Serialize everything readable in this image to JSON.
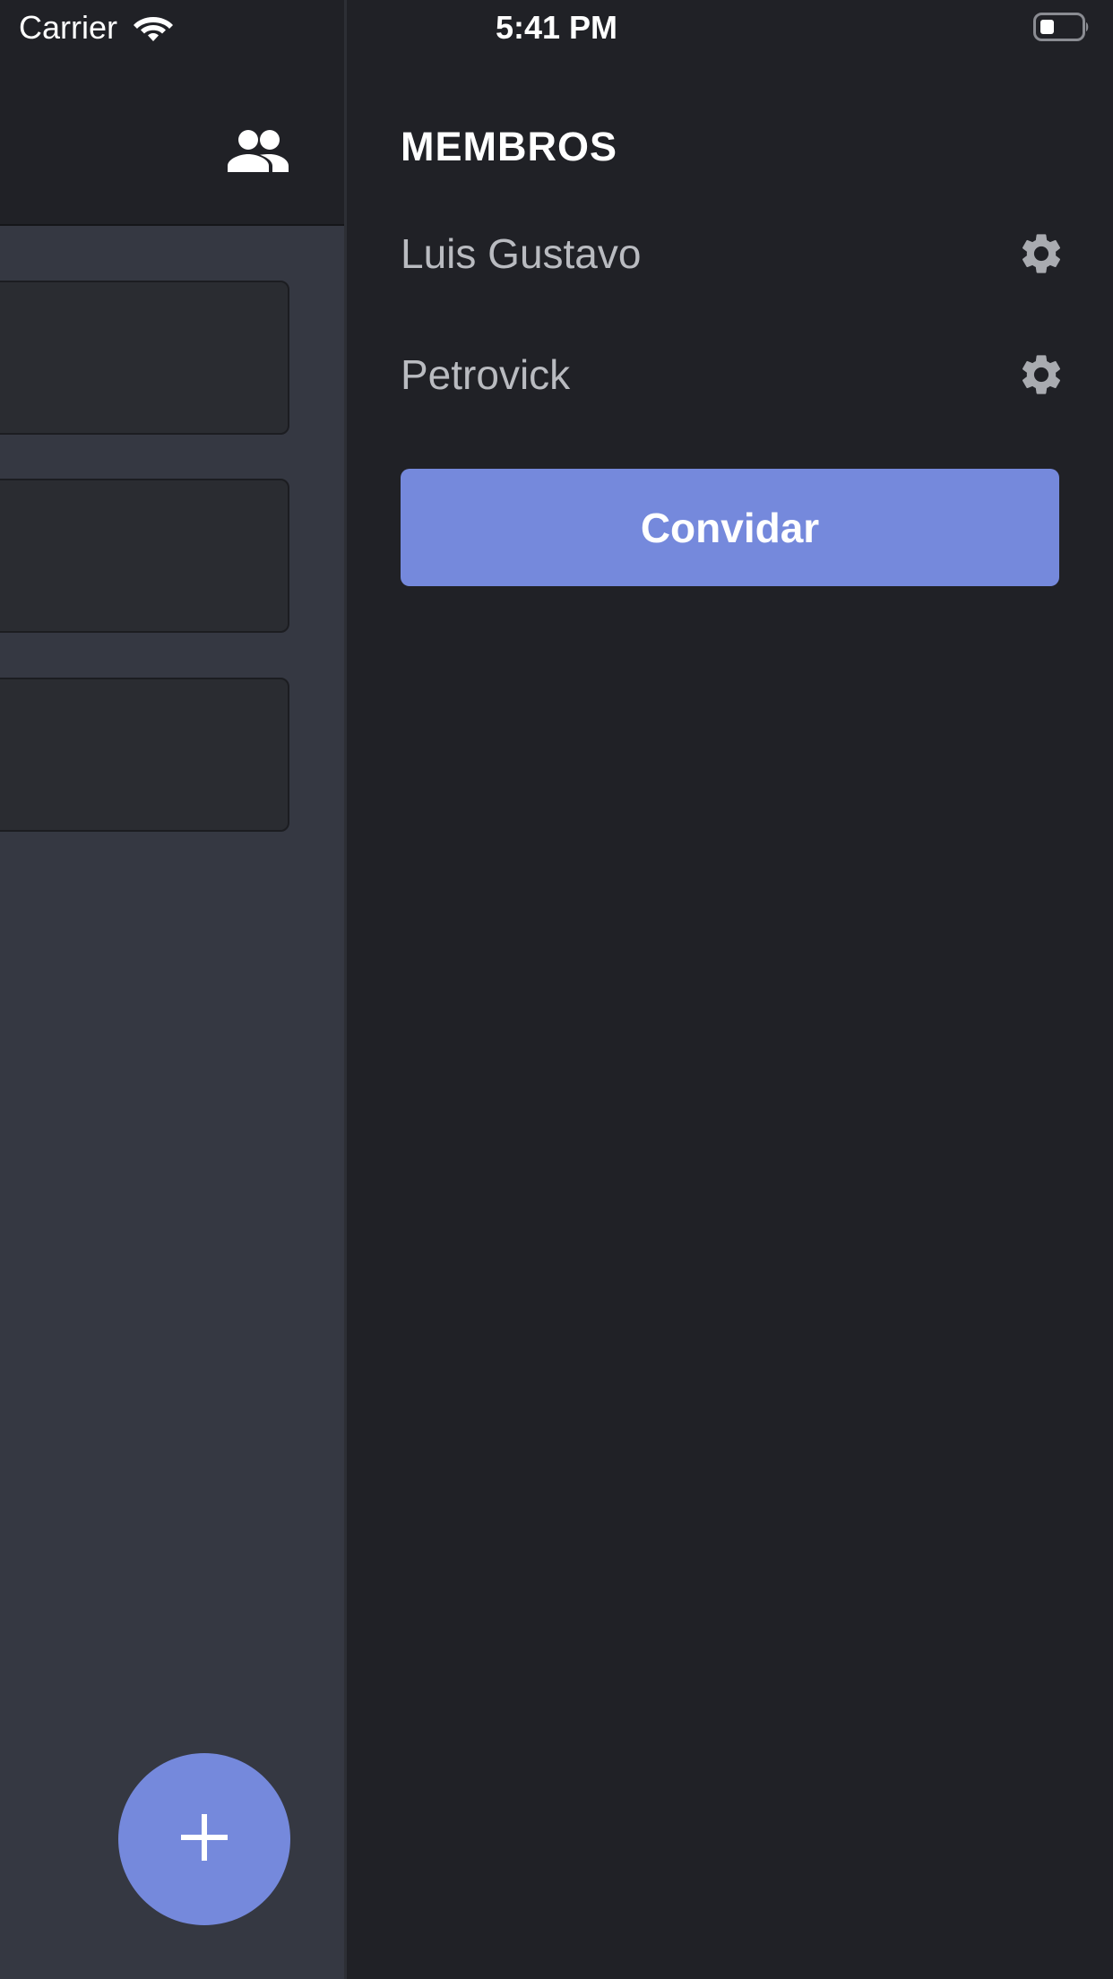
{
  "status_bar": {
    "carrier": "Carrier",
    "time": "5:41 PM",
    "wifi_icon": "wifi-icon",
    "battery_icon": "battery-icon"
  },
  "main": {
    "header_icon": "group-icon",
    "fab_icon": "plus-icon"
  },
  "drawer": {
    "title": "MEMBROS",
    "members": [
      {
        "name": "Luis Gustavo",
        "action_icon": "gear-icon"
      },
      {
        "name": "Petrovick",
        "action_icon": "gear-icon"
      }
    ],
    "invite_label": "Convidar"
  },
  "colors": {
    "accent": "#7589dc",
    "drawer_bg": "#202126",
    "main_bg": "#353842",
    "card_bg": "#2a2c31",
    "member_text": "#b9bbc0"
  }
}
